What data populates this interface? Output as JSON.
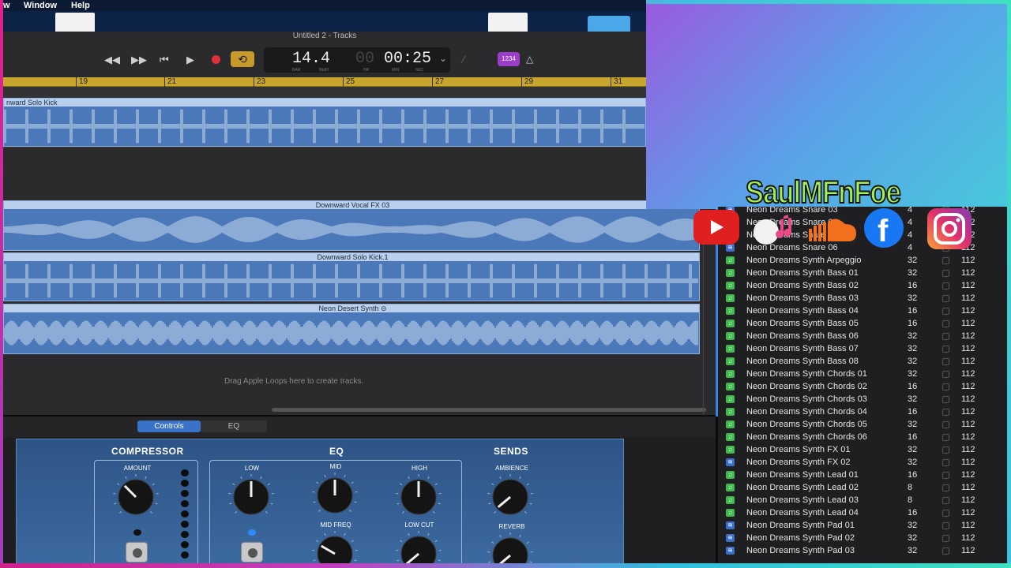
{
  "menubar": {
    "left_fragment": "w",
    "window": "Window",
    "help": "Help"
  },
  "window": {
    "title": "Untitled 2 - Tracks"
  },
  "transport": {
    "rewind": "◀◀",
    "forward": "▶▶",
    "to_start": "⏮",
    "play": "▶",
    "cycle": "⟲",
    "lcd_bar_beat": "14.4",
    "lcd_time": "00:25",
    "lcd_hr": "00",
    "lcd_labels": {
      "bar": "BAR",
      "beat": "BEAT",
      "hr": "HR",
      "min": "MIN",
      "sec": "SEC"
    },
    "key_button": "1234",
    "dropdown": "⌄"
  },
  "ruler": {
    "marks": [
      "19",
      "21",
      "23",
      "25",
      "27",
      "29",
      "31"
    ]
  },
  "regions": {
    "r1": "nward Solo Kick",
    "r2": "Downward Vocal FX 03",
    "r3": "Downward Solo Kick.1",
    "r4": "Neon Desert Synth"
  },
  "tracks_placeholder": "Drag Apple Loops here to create tracks.",
  "smart_controls": {
    "tabs": [
      "Controls",
      "EQ"
    ],
    "compressor": {
      "title": "COMPRESSOR",
      "amount": "AMOUNT"
    },
    "eq": {
      "title": "EQ",
      "low": "LOW",
      "mid": "MID",
      "high": "HIGH",
      "mid_freq": "MID FREQ",
      "low_cut": "LOW CUT"
    },
    "sends": {
      "title": "SENDS",
      "ambience": "AMBIENCE",
      "reverb": "REVERB"
    }
  },
  "overlay": {
    "channel": "SaulMFnFoe",
    "icons": [
      "youtube-icon",
      "apple-music-icon",
      "soundcloud-icon",
      "facebook-icon",
      "instagram-icon"
    ],
    "colors": {
      "youtube": "#e02020",
      "soundcloud": "#f26f1d",
      "facebook": "#1877f2",
      "instagram": "#c13584",
      "title": "#9ef05a"
    }
  },
  "loops": [
    {
      "name": "Neon Dreams Snare 03",
      "beats": "4",
      "tempo": "112",
      "type": "audio"
    },
    {
      "name": "Neon Dreams Snare 04",
      "beats": "4",
      "tempo": "112",
      "type": "audio"
    },
    {
      "name": "Neon Dreams Snare 05",
      "beats": "4",
      "tempo": "112",
      "type": "audio"
    },
    {
      "name": "Neon Dreams Snare 06",
      "beats": "4",
      "tempo": "112",
      "type": "audio"
    },
    {
      "name": "Neon Dreams Synth Arpeggio",
      "beats": "32",
      "tempo": "112",
      "type": "midi"
    },
    {
      "name": "Neon Dreams Synth Bass 01",
      "beats": "32",
      "tempo": "112",
      "type": "midi"
    },
    {
      "name": "Neon Dreams Synth Bass 02",
      "beats": "16",
      "tempo": "112",
      "type": "midi"
    },
    {
      "name": "Neon Dreams Synth Bass 03",
      "beats": "32",
      "tempo": "112",
      "type": "midi"
    },
    {
      "name": "Neon Dreams Synth Bass 04",
      "beats": "16",
      "tempo": "112",
      "type": "midi"
    },
    {
      "name": "Neon Dreams Synth Bass 05",
      "beats": "16",
      "tempo": "112",
      "type": "midi"
    },
    {
      "name": "Neon Dreams Synth Bass 06",
      "beats": "32",
      "tempo": "112",
      "type": "midi"
    },
    {
      "name": "Neon Dreams Synth Bass 07",
      "beats": "32",
      "tempo": "112",
      "type": "midi"
    },
    {
      "name": "Neon Dreams Synth Bass 08",
      "beats": "32",
      "tempo": "112",
      "type": "midi"
    },
    {
      "name": "Neon Dreams Synth Chords 01",
      "beats": "32",
      "tempo": "112",
      "type": "midi"
    },
    {
      "name": "Neon Dreams Synth Chords 02",
      "beats": "16",
      "tempo": "112",
      "type": "midi"
    },
    {
      "name": "Neon Dreams Synth Chords 03",
      "beats": "32",
      "tempo": "112",
      "type": "midi"
    },
    {
      "name": "Neon Dreams Synth Chords 04",
      "beats": "16",
      "tempo": "112",
      "type": "midi"
    },
    {
      "name": "Neon Dreams Synth Chords 05",
      "beats": "32",
      "tempo": "112",
      "type": "midi"
    },
    {
      "name": "Neon Dreams Synth Chords 06",
      "beats": "16",
      "tempo": "112",
      "type": "midi"
    },
    {
      "name": "Neon Dreams Synth FX 01",
      "beats": "32",
      "tempo": "112",
      "type": "midi"
    },
    {
      "name": "Neon Dreams Synth FX 02",
      "beats": "32",
      "tempo": "112",
      "type": "audio"
    },
    {
      "name": "Neon Dreams Synth Lead 01",
      "beats": "16",
      "tempo": "112",
      "type": "midi"
    },
    {
      "name": "Neon Dreams Synth Lead 02",
      "beats": "8",
      "tempo": "112",
      "type": "midi"
    },
    {
      "name": "Neon Dreams Synth Lead 03",
      "beats": "8",
      "tempo": "112",
      "type": "midi"
    },
    {
      "name": "Neon Dreams Synth Lead 04",
      "beats": "16",
      "tempo": "112",
      "type": "midi"
    },
    {
      "name": "Neon Dreams Synth Pad 01",
      "beats": "32",
      "tempo": "112",
      "type": "audio"
    },
    {
      "name": "Neon Dreams Synth Pad 02",
      "beats": "32",
      "tempo": "112",
      "type": "audio"
    },
    {
      "name": "Neon Dreams Synth Pad 03",
      "beats": "32",
      "tempo": "112",
      "type": "audio"
    }
  ],
  "colors": {
    "region": "#4a78b8",
    "region_header": "#b9cfec",
    "ruler": "#c8a52c",
    "record": "#e0303a",
    "cycle": "#c79a2a",
    "key": "#9a3ec8",
    "midi_icon": "#3dbb4c",
    "audio_icon": "#3a6fd0"
  }
}
